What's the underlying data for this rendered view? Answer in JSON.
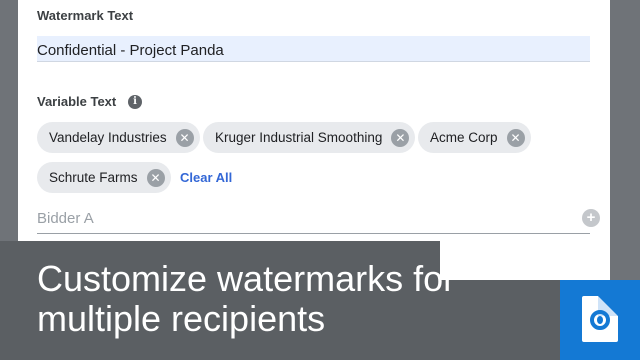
{
  "watermark": {
    "label": "Watermark Text",
    "value": "Confidential - Project Panda"
  },
  "variable_text": {
    "label": "Variable Text",
    "info_icon": "info-icon",
    "chips": [
      {
        "label": "Vandelay Industries"
      },
      {
        "label": "Kruger Industrial Smoothing"
      },
      {
        "label": "Acme Corp"
      },
      {
        "label": "Schrute Farms"
      }
    ],
    "clear_all_label": "Clear All",
    "input_placeholder": "Bidder A",
    "add_icon": "add-circle-icon"
  },
  "caption": "Customize watermarks for multiple recipients",
  "colors": {
    "accent": "#3367d6",
    "brand": "#1479d4",
    "field_highlight": "#e8f0fe",
    "caption_bg": "#5b5f63"
  },
  "brand_logo": "document-watermark-logo-icon"
}
